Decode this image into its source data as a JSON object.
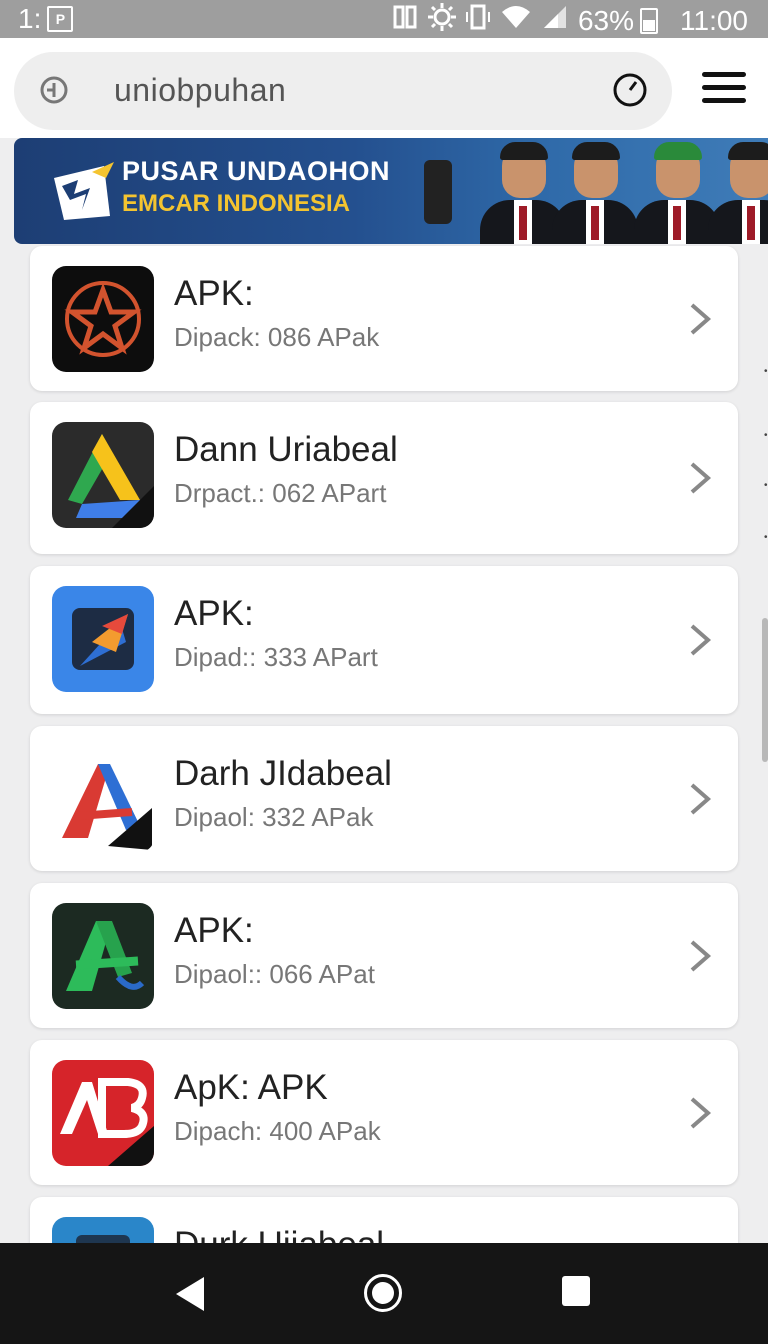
{
  "status_bar": {
    "left_text": "1:",
    "left_box": "P",
    "battery": "63%",
    "time": "11:00"
  },
  "search": {
    "query": "uniobpuhan"
  },
  "banner": {
    "line1": "PUSAR UNDAOHON",
    "line2": "EMCAR INDONESIA"
  },
  "apps": [
    {
      "title": "APK:",
      "subtitle": "Dipack: 086 APak",
      "icon": "star-app-icon"
    },
    {
      "title": "Dann Uriabeal",
      "subtitle": "Drpact.: 062 APart",
      "icon": "triangle-app-icon"
    },
    {
      "title": "APK:",
      "subtitle": "Dipad:: 333 APart",
      "icon": "arrow-app-icon"
    },
    {
      "title": "Darh JIdabeal",
      "subtitle": "Dipaol: 332 APak",
      "icon": "letter-a-app-icon"
    },
    {
      "title": "APK:",
      "subtitle": "Dipaol:: 066 APat",
      "icon": "green-a-app-icon"
    },
    {
      "title": "ApK: APK",
      "subtitle": "Dipach: 400 APak",
      "icon": "ab-app-icon"
    },
    {
      "title": "Durk Uiiabeal",
      "subtitle": "",
      "icon": "partial-app-icon"
    }
  ],
  "colors": {
    "status_bar": "#9e9e9e",
    "banner_bg": "#1d3e74",
    "banner_accent": "#f4c430",
    "nav_bar": "#151515"
  }
}
